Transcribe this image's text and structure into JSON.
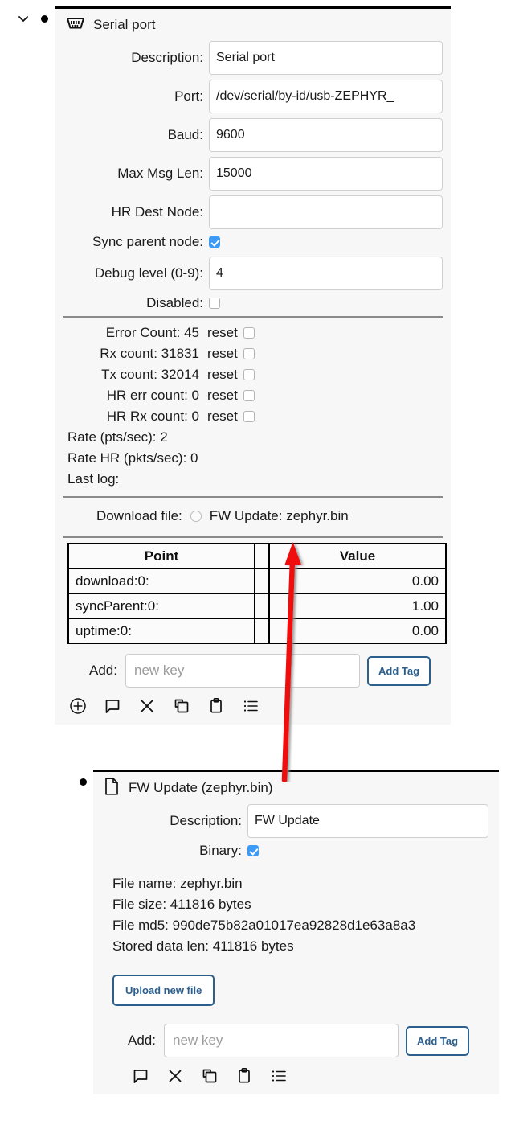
{
  "serial_port_node": {
    "icon": "serial-port-connector-icon",
    "chevron": "chevron-down-icon",
    "bullet": "bullet-dot-icon",
    "title": "Serial port",
    "fields": [
      {
        "label": "Description:",
        "value": "Serial port",
        "type": "text"
      },
      {
        "label": "Port:",
        "value": "/dev/serial/by-id/usb-ZEPHYR_",
        "type": "text"
      },
      {
        "label": "Baud:",
        "value": "9600",
        "type": "text"
      },
      {
        "label": "Max Msg Len:",
        "value": "15000",
        "type": "text"
      },
      {
        "label": "HR Dest Node:",
        "value": "",
        "type": "text"
      },
      {
        "label": "Sync parent node:",
        "value": "true",
        "type": "checkbox"
      },
      {
        "label": "Debug level (0-9):",
        "value": "4",
        "type": "text"
      },
      {
        "label": "Disabled:",
        "value": "false",
        "type": "checkbox"
      }
    ],
    "stats": [
      {
        "label": "Error Count: 45",
        "reset_label": "reset",
        "reset_checked": "false"
      },
      {
        "label": "Rx count: 31831",
        "reset_label": "reset",
        "reset_checked": "false"
      },
      {
        "label": "Tx count: 32014",
        "reset_label": "reset",
        "reset_checked": "false"
      },
      {
        "label": "HR err count: 0",
        "reset_label": "reset",
        "reset_checked": "false"
      },
      {
        "label": "HR Rx count: 0",
        "reset_label": "reset",
        "reset_checked": "false"
      }
    ],
    "plain_stats": [
      "Rate (pts/sec): 2",
      "Rate HR (pkts/sec): 0",
      "Last log:"
    ],
    "download": {
      "label": "Download file:",
      "radio_checked": "false",
      "option": "FW Update: zephyr.bin"
    },
    "tag_table": {
      "headers": {
        "point": "Point",
        "value": "Value"
      },
      "rows": [
        {
          "point": "download:0:",
          "value": "0.00"
        },
        {
          "point": "syncParent:0:",
          "value": "1.00"
        },
        {
          "point": "uptime:0:",
          "value": "0.00"
        }
      ]
    },
    "add": {
      "label": "Add:",
      "placeholder": "new key",
      "value": "",
      "button": "Add Tag"
    },
    "toolbar": [
      {
        "icon": "add-circle-icon"
      },
      {
        "icon": "comment-icon"
      },
      {
        "icon": "close-x-icon"
      },
      {
        "icon": "copy-icon"
      },
      {
        "icon": "paste-clipboard-icon"
      },
      {
        "icon": "list-icon"
      }
    ]
  },
  "fw_update_node": {
    "icon": "file-document-icon",
    "bullet": "bullet-dot-icon",
    "title": "FW Update (zephyr.bin)",
    "fields": [
      {
        "label": "Description:",
        "value": "FW Update",
        "type": "text"
      },
      {
        "label": "Binary:",
        "value": "true",
        "type": "checkbox"
      }
    ],
    "info": [
      "File name: zephyr.bin",
      "File size: 411816 bytes",
      "File md5: 990de75b82a01017ea92828d1e63a8a3",
      "Stored data len: 411816 bytes"
    ],
    "upload_button": "Upload new file",
    "add": {
      "label": "Add:",
      "placeholder": "new key",
      "value": "",
      "button": "Add Tag"
    },
    "toolbar": [
      {
        "icon": "comment-icon"
      },
      {
        "icon": "close-x-icon"
      },
      {
        "icon": "copy-icon"
      },
      {
        "icon": "paste-clipboard-icon"
      },
      {
        "icon": "list-icon"
      }
    ]
  },
  "annotation": {
    "arrow": "red-arrow-pointing-up",
    "color": "#f01010"
  },
  "colors": {
    "panel_bg": "#f7f7f7",
    "panel_top_border": "#000000",
    "checkbox_checked": "#3d9bf5",
    "button_border": "#2c5f8e",
    "button_text": "#2c5f8e",
    "annotation_red": "#f01010"
  }
}
